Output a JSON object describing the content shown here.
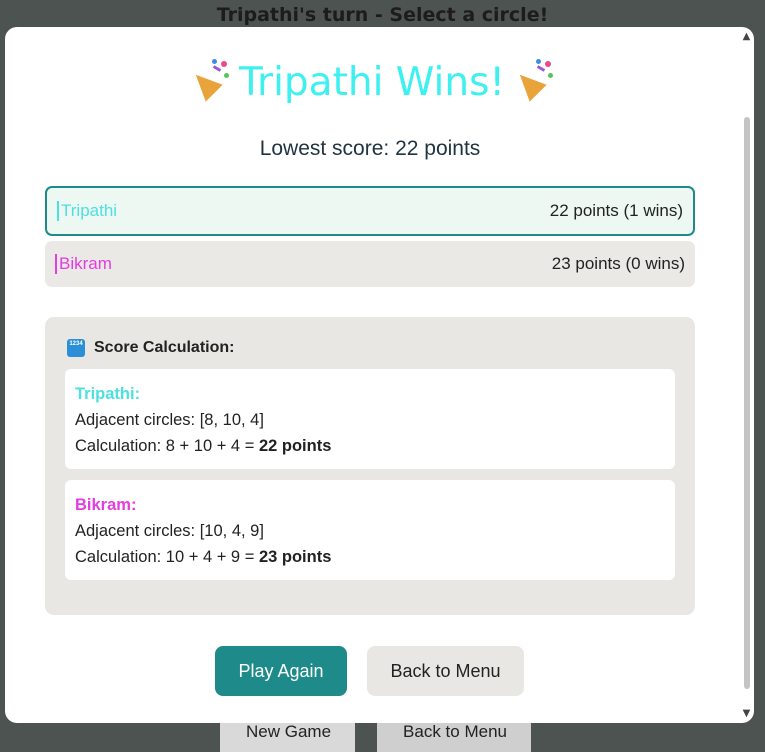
{
  "background": {
    "turn_text": "Tripathi's turn - Select a circle!",
    "buttons": [
      "New Game",
      "Back to Menu"
    ]
  },
  "modal": {
    "title": "Tripathi Wins!",
    "title_icon": "party-popper-icon",
    "lowest_score": "Lowest score: 22 points",
    "players": [
      {
        "name": "Tripathi",
        "score": "22 points (1 wins)",
        "color": "#4de0e0"
      },
      {
        "name": "Bikram",
        "score": "23 points (0 wins)",
        "color": "#e33ce0"
      }
    ],
    "calc_heading": "Score Calculation:",
    "calc_icon": "numbers-icon",
    "calc_icon_text": "1234",
    "calculations": [
      {
        "name": "Tripathi:",
        "adjacent": "Adjacent circles: [8, 10, 4]",
        "calc_prefix": "Calculation: 8 + 10 + 4 =",
        "total": "22 points"
      },
      {
        "name": "Bikram:",
        "adjacent": "Adjacent circles: [10, 4, 9]",
        "calc_prefix": "Calculation: 10 + 4 + 9 =",
        "total": "23 points"
      }
    ],
    "play_again_label": "Play Again",
    "back_label": "Back to Menu"
  },
  "colors": {
    "accent": "#1e8a8a",
    "title": "#3ef0f0"
  }
}
